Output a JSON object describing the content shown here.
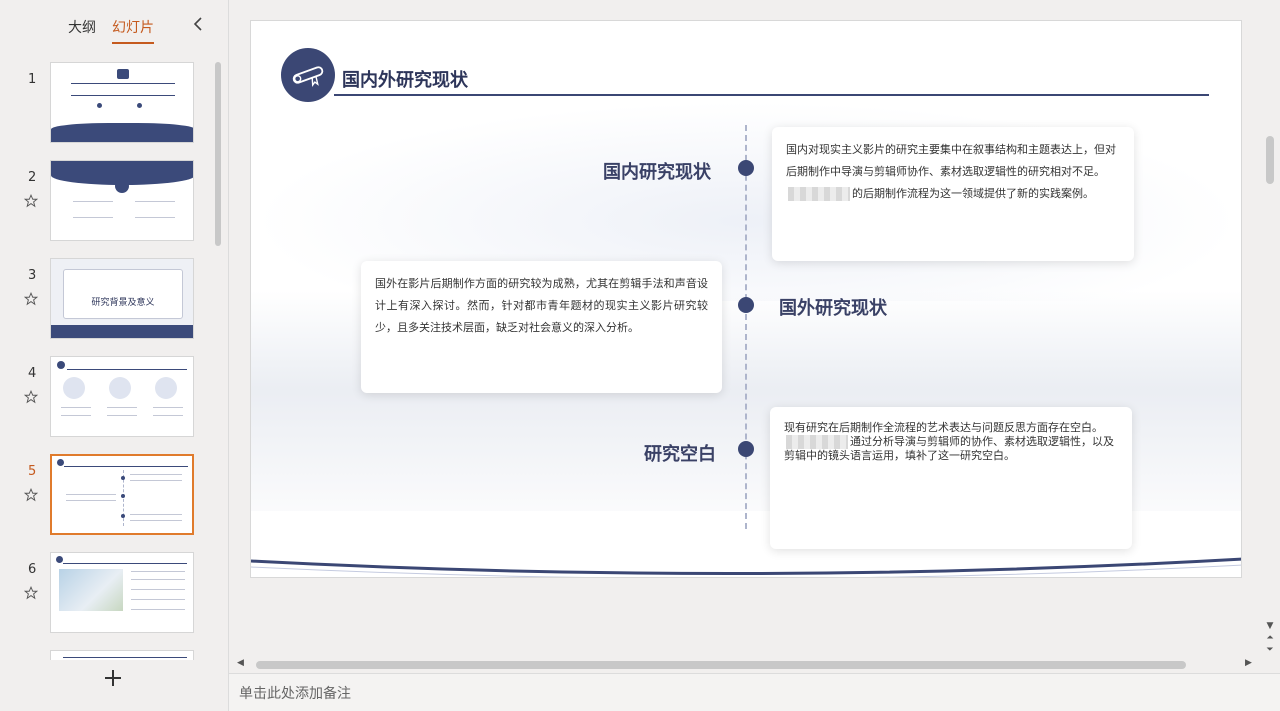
{
  "panel": {
    "tabs": [
      {
        "label": "大纲",
        "active": false
      },
      {
        "label": "幻灯片",
        "active": true
      }
    ],
    "collapse_icon": "chevron-left-icon",
    "add_icon": "plus-icon"
  },
  "thumbnails": [
    {
      "num": "1",
      "starred": false,
      "active": false
    },
    {
      "num": "2",
      "starred": true,
      "active": false
    },
    {
      "num": "3",
      "starred": true,
      "active": false,
      "text": "研究背景及意义"
    },
    {
      "num": "4",
      "starred": true,
      "active": false
    },
    {
      "num": "5",
      "starred": true,
      "active": true
    },
    {
      "num": "6",
      "starred": true,
      "active": false
    }
  ],
  "slide": {
    "title": "国内外研究现状",
    "items": [
      {
        "label": "国内研究现状",
        "text_before": "国内对现实主义影片的研究主要集中在叙事结构和主题表达上，但对后期制作中导演与剪辑师协作、素材选取逻辑性的研究相对不足。",
        "text_after": "的后期制作流程为这一领域提供了新的实践案例。"
      },
      {
        "label": "国外研究现状",
        "text": "国外在影片后期制作方面的研究较为成熟，尤其在剪辑手法和声音设计上有深入探讨。然而，针对都市青年题材的现实主义影片研究较少，且多关注技术层面，缺乏对社会意义的深入分析。"
      },
      {
        "label": "研究空白",
        "text_before": "现有研究在后期制作全流程的艺术表达与问题反思方面存在空白。",
        "text_after": "通过分析导演与剪辑师的协作、素材选取逻辑性，以及剪辑中的镜头语言运用，填补了这一研究空白。"
      }
    ],
    "accent_color": "#3b4774"
  },
  "notes": {
    "placeholder": "单击此处添加备注"
  }
}
